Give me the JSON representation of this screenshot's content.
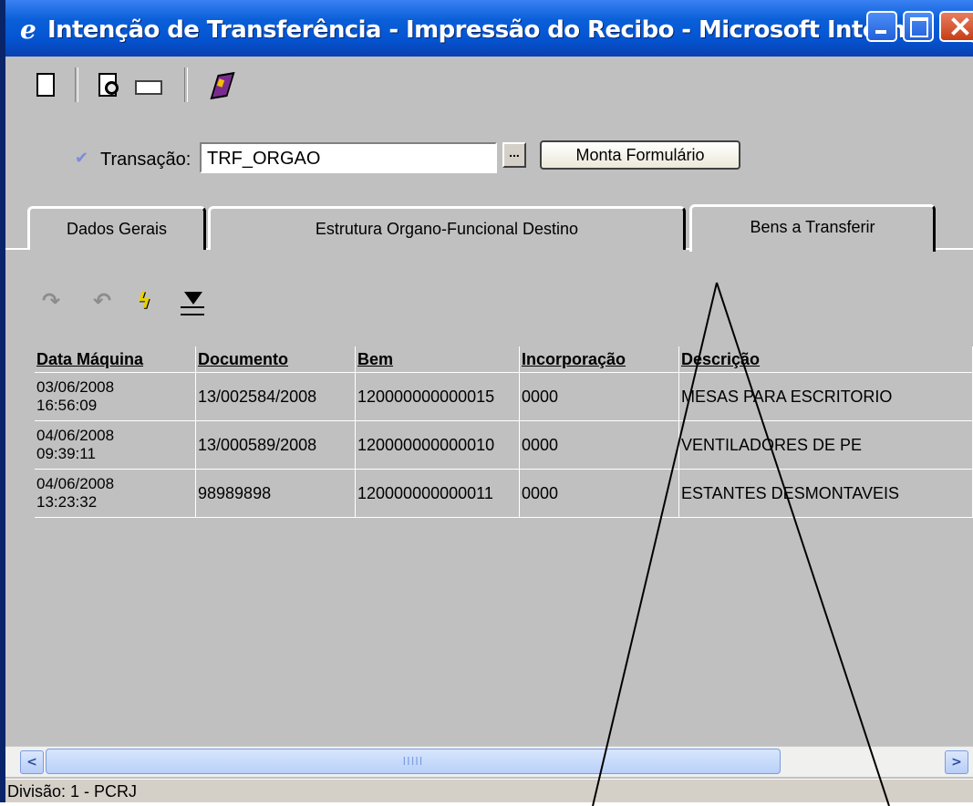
{
  "window": {
    "title": "Intenção de Transferência - Impressão do Recibo - Microsoft Internet Exp...",
    "icon": "ie-logo-icon",
    "title_icon_glyph": "e"
  },
  "toolbar": {
    "icons": [
      "new-document-icon",
      "print-preview-icon",
      "card-icon",
      "book-icon"
    ]
  },
  "transaction": {
    "label": "Transação:",
    "value": "TRF_ORGAO",
    "ellipsis_label": "...",
    "build_form_label": "Monta Formulário"
  },
  "tabs": [
    {
      "label": "Dados Gerais",
      "active": false
    },
    {
      "label": "Estrutura Organo-Funcional Destino",
      "active": false
    },
    {
      "label": "Bens a Transferir",
      "active": true
    }
  ],
  "grid_toolbar": {
    "icons": [
      "redo-icon",
      "undo-icon",
      "lightning-icon",
      "add-filter-icon"
    ]
  },
  "table": {
    "columns": [
      "Data Máquina",
      "Documento",
      "Bem",
      "Incorporação",
      "Descrição"
    ],
    "rows": [
      {
        "date": "03/06/2008",
        "time": "16:56:09",
        "documento": "13/002584/2008",
        "bem": "120000000000015",
        "incorporacao": "0000",
        "descricao": "MESAS PARA ESCRITORIO"
      },
      {
        "date": "04/06/2008",
        "time": "09:39:11",
        "documento": "13/000589/2008",
        "bem": "120000000000010",
        "incorporacao": "0000",
        "descricao": "VENTILADORES DE PE"
      },
      {
        "date": "04/06/2008",
        "time": "13:23:32",
        "documento": "98989898",
        "bem": "120000000000011",
        "incorporacao": "0000",
        "descricao": "ESTANTES DESMONTAVEIS"
      }
    ]
  },
  "scrollbar": {
    "thumb_grip": "IIIII"
  },
  "status_bar": {
    "text": "Divisão: 1 - PCRJ"
  },
  "colors": {
    "titlebar": "#0454d1",
    "window_bg": "#c0c0c0",
    "close_button": "#c63d16"
  }
}
